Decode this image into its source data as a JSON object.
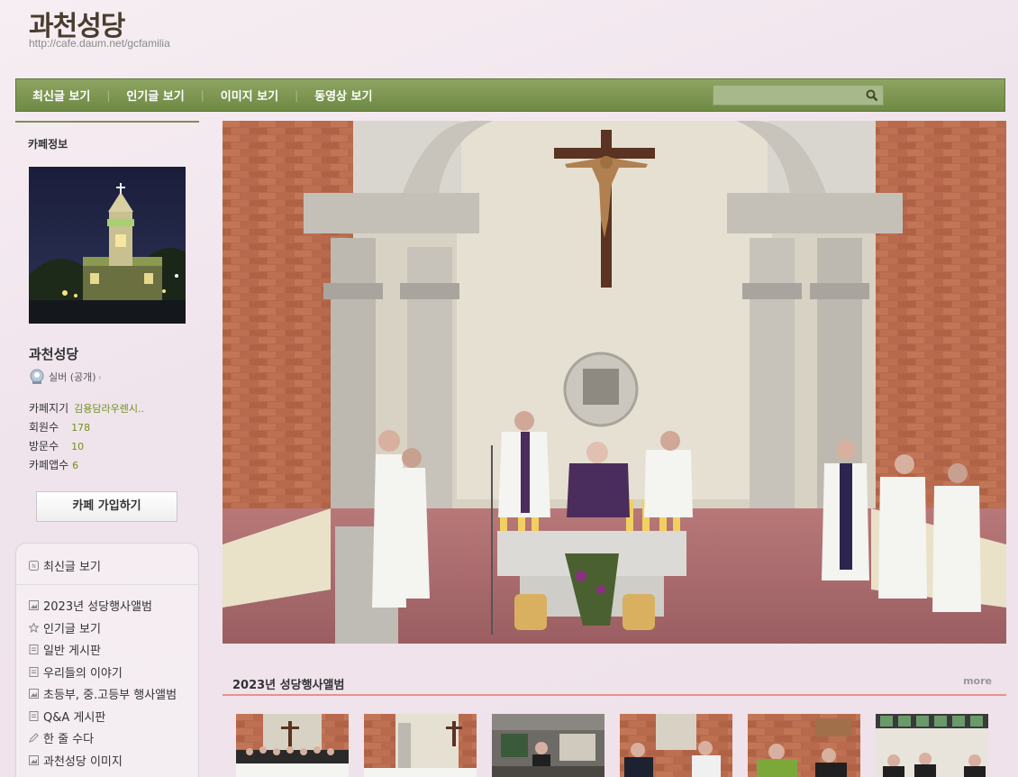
{
  "header": {
    "title": "과천성당",
    "url": "http://cafe.daum.net/gcfamilia"
  },
  "nav": {
    "items": [
      "최신글 보기",
      "인기글 보기",
      "이미지 보기",
      "동영상 보기"
    ],
    "search_placeholder": ""
  },
  "sidebar": {
    "section_label": "카페정보",
    "cafe_name": "과천성당",
    "grade": "실버 (공개)",
    "stats": [
      {
        "label": "카페지기",
        "value": "김용담라우렌시.."
      },
      {
        "label": "회원수",
        "value": "178"
      },
      {
        "label": "방문수",
        "value": "10"
      },
      {
        "label": "카페앱수",
        "value": "6"
      }
    ],
    "join_button": "카페 가입하기",
    "menu_first": "최신글 보기",
    "menu_items": [
      {
        "label": "2023년 성당행사앨범",
        "icon": "album-icon"
      },
      {
        "label": "인기글 보기",
        "icon": "star-icon"
      },
      {
        "label": "일반 게시판",
        "icon": "board-icon"
      },
      {
        "label": "우리들의 이야기",
        "icon": "board-icon"
      },
      {
        "label": "초등부, 중.고등부 행사앨범",
        "icon": "album-icon"
      },
      {
        "label": "Q&A 게시판",
        "icon": "board-icon"
      },
      {
        "label": "한 줄 수다",
        "icon": "pencil-icon"
      },
      {
        "label": "과천성당 이미지",
        "icon": "album-icon"
      }
    ]
  },
  "album": {
    "title": "2023년 성당행사앨범",
    "more": "more"
  },
  "colors": {
    "nav_bg": "#7a9450",
    "accent_green": "#6f8f1e",
    "album_line": "#e8928f"
  }
}
